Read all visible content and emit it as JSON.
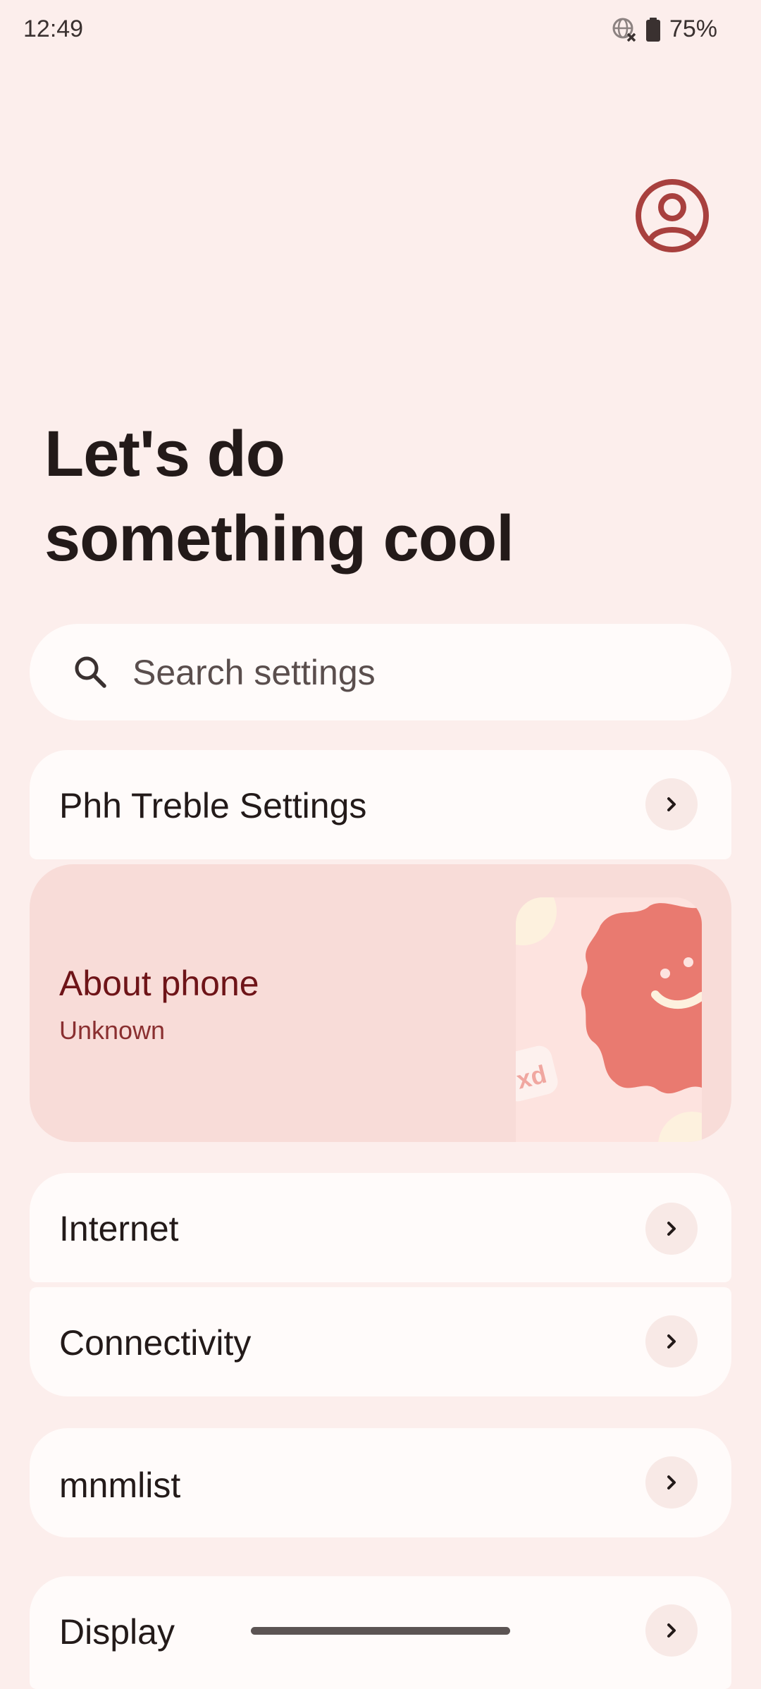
{
  "status_bar": {
    "time": "12:49",
    "battery": "75%",
    "icons": [
      "globe-no-connection-icon",
      "battery-icon"
    ]
  },
  "header": {
    "avatar_icon": "account-circle-icon",
    "title_line1": "Let's do",
    "title_line2": "something cool"
  },
  "search": {
    "placeholder": "Search settings",
    "icon": "search-icon"
  },
  "settings": [
    {
      "label": "Phh Treble Settings",
      "icon": "chevron-right-icon"
    },
    {
      "label": "About phone",
      "subtitle": "Unknown"
    },
    {
      "label": "Internet",
      "icon": "chevron-right-icon"
    },
    {
      "label": "Connectivity",
      "icon": "chevron-right-icon"
    },
    {
      "label": "mnmlist",
      "icon": "chevron-right-icon"
    },
    {
      "label": "Display",
      "icon": "chevron-right-icon"
    }
  ],
  "about_card": {
    "illustration_text": "xd"
  },
  "colors": {
    "background": "#FCEEEC",
    "card": "#FFFBFA",
    "accent": "#A8403E",
    "about_bg": "#F8DCD8",
    "about_title": "#6E1418"
  }
}
